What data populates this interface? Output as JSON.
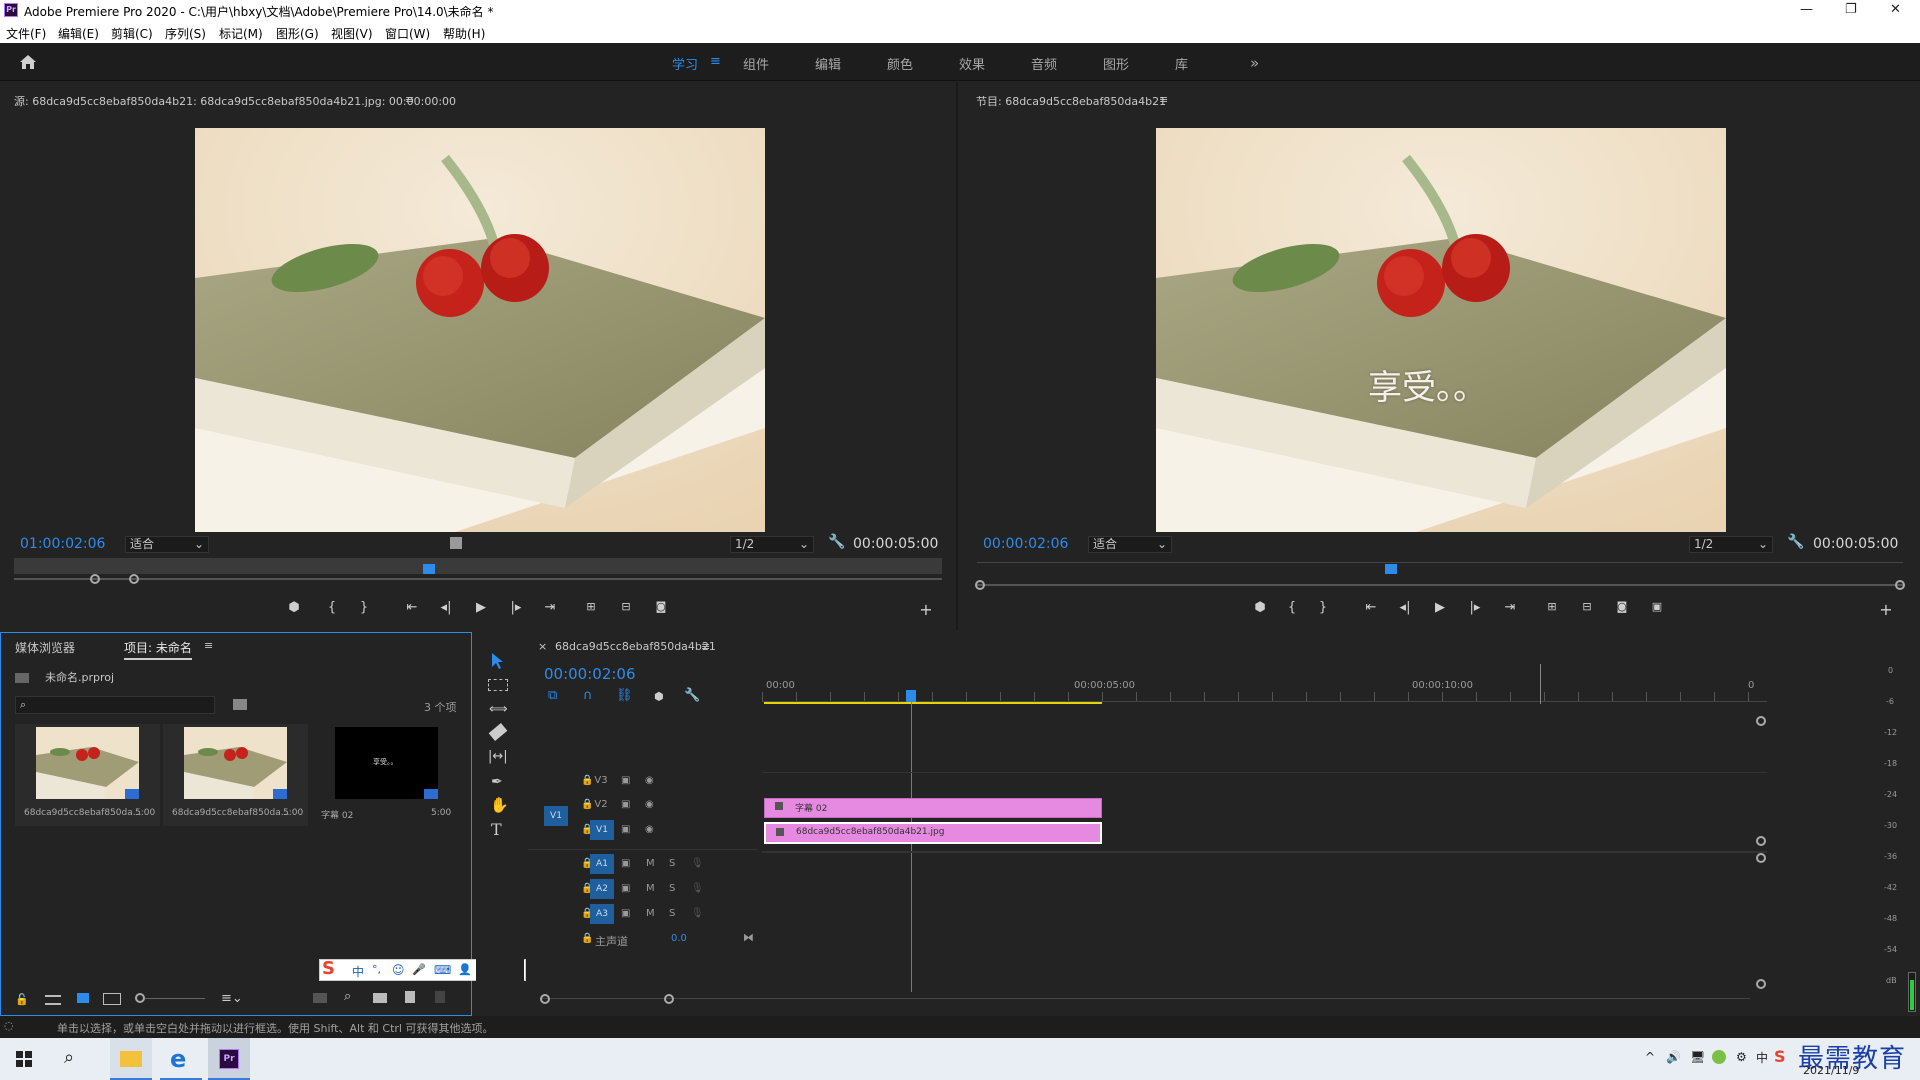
{
  "title_bar": {
    "app_icon": "Pr",
    "title": "Adobe Premiere Pro 2020 - C:\\用户\\hbxy\\文档\\Adobe\\Premiere Pro\\14.0\\未命名 *",
    "minimize": "—",
    "restore": "❐",
    "close": "✕"
  },
  "menu": [
    "文件(F)",
    "编辑(E)",
    "剪辑(C)",
    "序列(S)",
    "标记(M)",
    "图形(G)",
    "视图(V)",
    "窗口(W)",
    "帮助(H)"
  ],
  "workspaces": [
    "学习",
    "组件",
    "编辑",
    "颜色",
    "效果",
    "音频",
    "图形",
    "库"
  ],
  "workspace_active_icon": "≡",
  "workspace_more": "»",
  "source": {
    "header": "源: 68dca9d5cc8ebaf850da4b21: 68dca9d5cc8ebaf850da4b21.jpg: 00:00:00:00",
    "menu_icon": "≡",
    "timecode": "01:00:02:06",
    "fit": "适合",
    "res": "1/2",
    "duration": "00:00:05:00"
  },
  "program": {
    "header": "节目: 68dca9d5cc8ebaf850da4b21",
    "menu_icon": "≡",
    "timecode": "00:00:02:06",
    "fit": "适合",
    "res": "1/2",
    "duration": "00:00:05:00",
    "overlay_text": "享受。。"
  },
  "transport_controls": {
    "mark": "⬢",
    "in": "{",
    "out": "}",
    "goto_in": "⇤",
    "step_back": "◂|",
    "play": "▶",
    "step_fwd": "|▸",
    "goto_out": "⇥",
    "add": "+"
  },
  "project": {
    "tab_media": "媒体浏览器",
    "tab_project": "项目: 未命名",
    "menu_icon": "≡",
    "file": "未命名.prproj",
    "count": "3 个项",
    "items": [
      {
        "name": "68dca9d5cc8ebaf850da...",
        "dur": "5:00"
      },
      {
        "name": "68dca9d5cc8ebaf850da...",
        "dur": "5:00"
      },
      {
        "name": "字幕 02",
        "dur": "5:00",
        "thumb_text": "享受。。"
      }
    ]
  },
  "ime_toolbar": {
    "logo": "S",
    "items": [
      "中",
      "°,",
      "☺",
      "🎤",
      "⌨",
      "👤",
      "👕",
      "▦"
    ]
  },
  "timeline": {
    "tab": "68dca9d5cc8ebaf850da4b21",
    "close": "×",
    "menu_icon": "≡",
    "timecode": "00:00:02:06",
    "ruler": [
      "00:00",
      "00:00:05:00",
      "00:00:10:00",
      "0"
    ],
    "video_tracks": [
      "V3",
      "V2",
      "V1"
    ],
    "source_patch": "V1",
    "audio_tracks": [
      "A1",
      "A2",
      "A3"
    ],
    "audio_m": "M",
    "audio_s": "S",
    "master": "主声道",
    "master_value": "0.0",
    "clip_title": "字幕 02",
    "clip_image": "68dca9d5cc8ebaf850da4b21.jpg"
  },
  "meter_scale": [
    "0",
    "-6",
    "-12",
    "-18",
    "-24",
    "-30",
    "-36",
    "-42",
    "-48",
    "-54",
    "dB"
  ],
  "status": "单击以选择，或单击空白处并拖动以进行框选。使用 Shift、Alt 和 Ctrl 可获得其他选项。",
  "taskbar": {
    "date": "2021/11/9",
    "watermark": "最需教育",
    "tray_lang": "中"
  },
  "colors": {
    "accent": "#2d8ceb",
    "clip_pink": "#e58ae0",
    "bg": "#232323"
  }
}
